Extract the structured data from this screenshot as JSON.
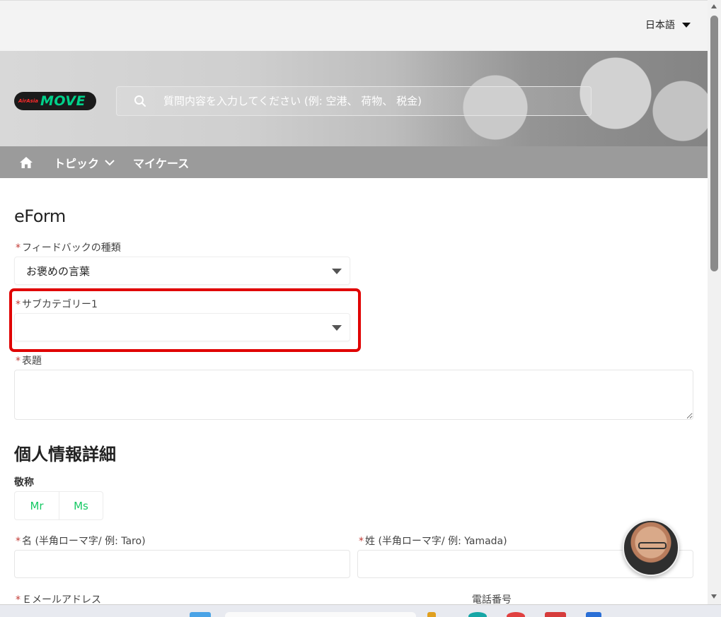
{
  "header": {
    "language": "日本語",
    "logo": {
      "brand_mark": "AirAsia",
      "word": "MOVE"
    },
    "search_placeholder": "質問内容を入力してください (例: 空港、 荷物、 税金)"
  },
  "nav": {
    "home_icon": "home-icon",
    "items": [
      {
        "label": "トピック",
        "has_dropdown": true
      },
      {
        "label": "マイケース",
        "has_dropdown": false
      }
    ]
  },
  "form": {
    "title": "eForm",
    "fields": {
      "feedback_type": {
        "required_mark": "*",
        "label": "フィードバックの種類",
        "value": "お褒めの言葉"
      },
      "subcategory1": {
        "required_mark": "*",
        "label": "サブカテゴリー1",
        "value": ""
      },
      "subject": {
        "required_mark": "*",
        "label": "表題",
        "value": ""
      }
    }
  },
  "personal": {
    "title": "個人情報詳細",
    "salutation_label": "敬称",
    "salutations": [
      "Mr",
      "Ms"
    ],
    "first_name": {
      "required_mark": "*",
      "label": "名 (半角ローマ字/ 例: Taro)"
    },
    "last_name": {
      "required_mark": "*",
      "label": "姓 (半角ローマ字/ 例: Yamada)"
    },
    "email": {
      "required_mark": "*",
      "label": "Ｅメールアドレス"
    },
    "phone": {
      "label": "電話番号"
    }
  },
  "colors": {
    "accent_green": "#17c964",
    "required_red": "#c23934",
    "highlight_red": "#e00000",
    "nav_gray": "#9b9b9b"
  }
}
